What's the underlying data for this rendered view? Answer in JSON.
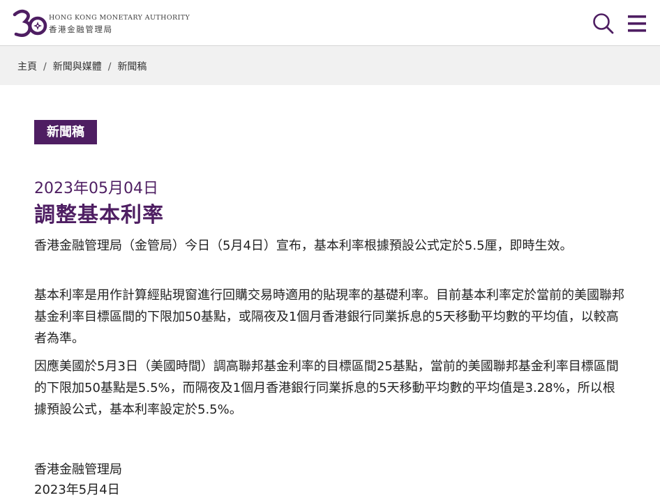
{
  "header": {
    "logo": {
      "anniversary_mark": "30",
      "name_en": "HONG KONG MONETARY AUTHORITY",
      "name_zh": "香港金融管理局"
    },
    "search_icon": "search-icon",
    "menu_icon": "hamburger-menu-icon",
    "brand_color": "#4e1e62"
  },
  "breadcrumb": {
    "items": [
      "主頁",
      "新聞與媒體",
      "新聞稿"
    ],
    "separator": "/"
  },
  "article": {
    "category_tag": "新聞稿",
    "date": "2023年05月04日",
    "title": "調整基本利率",
    "paragraphs": [
      "香港金融管理局（金管局）今日（5月4日）宣布，基本利率根據預設公式定於5.5厘，即時生效。",
      "基本利率是用作計算經貼現窗進行回購交易時適用的貼現率的基礎利率。目前基本利率定於當前的美國聯邦基金利率目標區間的下限加50基點，或隔夜及1個月香港銀行同業拆息的5天移動平均數的平均值，以較高者為準。",
      "因應美國於5月3日（美國時間）調高聯邦基金利率的目標區間25基點，當前的美國聯邦基金利率目標區間的下限加50基點是5.5%，而隔夜及1個月香港銀行同業拆息的5天移動平均數的平均值是3.28%，所以根據預設公式，基本利率設定於5.5%。"
    ],
    "signature": {
      "organisation": "香港金融管理局",
      "date": "2023年5月4日"
    }
  }
}
